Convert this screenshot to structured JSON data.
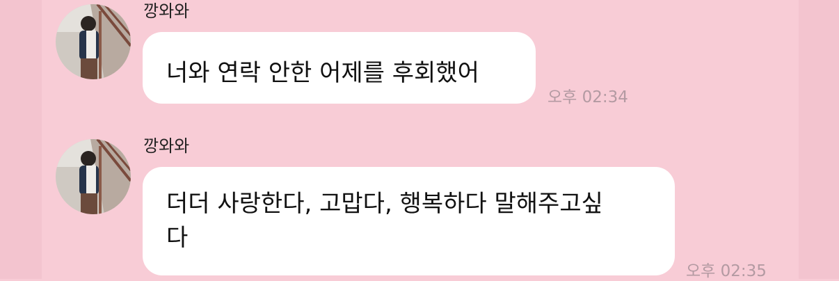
{
  "chat": {
    "messages": [
      {
        "sender": "깡와와",
        "text": "너와 연락 안한 어제를 후회했어",
        "time": "오후 02:34"
      },
      {
        "sender": "깡와와",
        "text": "더더 사랑한다, 고맙다, 행복하다 말해주고싶\n다",
        "time": "오후 02:35"
      }
    ]
  },
  "colors": {
    "background": "#f8ccd6",
    "bubble": "#ffffff",
    "timestamp": "#b39aa2"
  }
}
